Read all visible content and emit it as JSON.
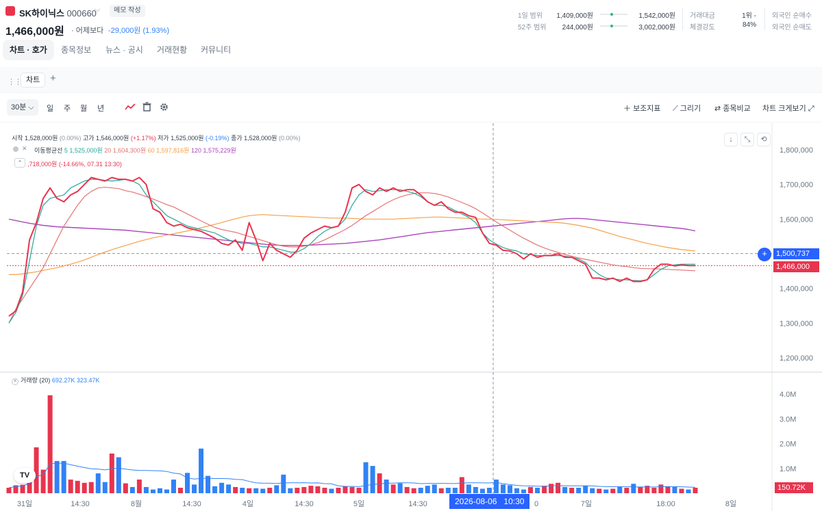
{
  "header": {
    "stock_name": "SK하이닉스",
    "stock_code": "000660",
    "memo_label": "메모 작성",
    "price": "1,466,000원",
    "change_label": "· 어제보다",
    "change_value": "-29,000원 (1.93%)",
    "range_1d_label": "1일 범위",
    "range_1d_low": "1,409,000원",
    "range_1d_high": "1,542,000원",
    "range_52w_label": "52주 범위",
    "range_52w_low": "244,000원",
    "range_52w_high": "3,002,000원",
    "trade_amount_label": "거래대금",
    "trade_amount_value": "1위 -",
    "strength_label": "체결강도",
    "strength_value": "84%",
    "foreign_buy_label": "외국인 순매수",
    "foreign_rate_label": "외국인 순매도"
  },
  "tabs": [
    {
      "label": "차트 · 호가"
    },
    {
      "label": "종목정보"
    },
    {
      "label": "뉴스 · 공시"
    },
    {
      "label": "거래현황"
    },
    {
      "label": "커뮤니티"
    }
  ],
  "panel": {
    "chart_tab": "차트",
    "add_tab": "+"
  },
  "toolbar": {
    "interval": "30분",
    "periods": [
      "일",
      "주",
      "월",
      "년"
    ],
    "indicators": "보조지표",
    "draw": "그리기",
    "compare": "종목비교",
    "enlarge": "차트 크게보기"
  },
  "legend": {
    "ohlc_text_1": "시작 1,528,000원",
    "ohlc_pct_1": "(0.00%)",
    "ohlc_text_2": "고가 1,546,000원",
    "ohlc_pct_2": "(+1.17%)",
    "ohlc_text_3": "저가 1,525,000원",
    "ohlc_pct_3": "(-0.19%)",
    "ohlc_text_4": "종가 1,528,000원",
    "ohlc_pct_4": "(0.00%)",
    "ma_label": "이동평균선",
    "ma5": "5 1,525,000원",
    "ma20": "20 1,604,300원",
    "ma60": "60 1,597,816원",
    "ma120": "120 1,575,229원",
    "low_note": ",718,000원 (-14.66%, 07.31 13:30)",
    "volume_label": "거래량 (20)",
    "volume_v1": "692.27K",
    "volume_v2": "323.47K"
  },
  "axis": {
    "price_ticks": [
      "1,800,000",
      "1,700,000",
      "1,600,000",
      "1,500,000",
      "1,400,000",
      "1,300,000",
      "1,200,000"
    ],
    "volume_ticks": [
      "4.0M",
      "3.0M",
      "2.0M",
      "1.0M"
    ],
    "x_ticks": [
      "31일",
      "14:30",
      "8월",
      "14:30",
      "4일",
      "14:30",
      "5일",
      "14:30",
      "0",
      "7일",
      "18:00",
      "8일"
    ],
    "crosshair_date": "2026-08-06",
    "crosshair_time": "10:30",
    "crosshair_price": "1,500,737",
    "last_price": "1,466,000",
    "last_volume": "150.72K"
  },
  "colors": {
    "up": "#e8344e",
    "down": "#3182f6",
    "ma5": "#26a69a",
    "ma20": "#e57373",
    "ma60": "#f5a04a",
    "ma120": "#ab47bc",
    "crosshair": "#2962ff"
  },
  "chart_data": {
    "type": "line",
    "title": "",
    "xlabel": "",
    "ylabel": "",
    "ylim": [
      1150000,
      1850000
    ],
    "x": [
      0,
      1,
      2,
      3,
      4,
      5,
      6,
      7,
      8,
      9,
      10,
      11,
      12,
      13,
      14,
      15,
      16,
      17,
      18,
      19,
      20,
      21,
      22,
      23,
      24,
      25,
      26,
      27,
      28,
      29,
      30,
      31,
      32,
      33,
      34,
      35,
      36,
      37,
      38,
      39,
      40,
      41,
      42,
      43,
      44,
      45,
      46,
      47,
      48,
      49,
      50,
      51,
      52,
      53,
      54,
      55,
      56,
      57,
      58,
      59,
      60,
      61,
      62,
      63,
      64,
      65,
      66,
      67,
      68,
      69,
      70,
      71,
      72,
      73,
      74,
      75,
      76,
      77,
      78,
      79,
      80,
      81,
      82,
      83,
      84,
      85,
      86,
      87,
      88,
      89,
      90,
      91,
      92,
      93,
      94,
      95,
      96,
      97,
      98,
      99,
      100
    ],
    "series": [
      {
        "name": "",
        "values": [
          1320000,
          1335000,
          1390000,
          1540000,
          1590000,
          1660000,
          1690000,
          1660000,
          1650000,
          1670000,
          1680000,
          1700000,
          1720000,
          1715000,
          1710000,
          1720000,
          1715000,
          1715000,
          1710000,
          1720000,
          1700000,
          1630000,
          1620000,
          1590000,
          1580000,
          1585000,
          1575000,
          1570000,
          1565000,
          1555000,
          1545000,
          1530000,
          1525000,
          1540000,
          1510000,
          1590000,
          1540000,
          1480000,
          1530000,
          1510000,
          1500000,
          1490000,
          1510000,
          1545000,
          1560000,
          1570000,
          1580000,
          1575000,
          1580000,
          1620000,
          1690000,
          1700000,
          1680000,
          1670000,
          1690000,
          1680000,
          1690000,
          1680000,
          1685000,
          1685000,
          1670000,
          1650000,
          1640000,
          1650000,
          1630000,
          1620000,
          1620000,
          1610000,
          1605000,
          1560000,
          1530000,
          1525000,
          1510000,
          1508000,
          1500000,
          1485000,
          1500000,
          1490000,
          1495000,
          1495000,
          1500000,
          1490000,
          1490000,
          1480000,
          1470000,
          1430000,
          1430000,
          1425000,
          1430000,
          1420000,
          1430000,
          1420000,
          1420000,
          1425000,
          1455000,
          1470000,
          1470000,
          1465000,
          1468000,
          1466000,
          1466000
        ]
      },
      {
        "name": "",
        "values": [
          1300000,
          1330000,
          1380000,
          1480000,
          1580000,
          1640000,
          1660000,
          1665000,
          1670000,
          1690000,
          1700000,
          1710000,
          1715000,
          1715000,
          1712000,
          1710000,
          1712000,
          1715000,
          1710000,
          1700000,
          1670000,
          1650000,
          1630000,
          1610000,
          1600000,
          1590000,
          1580000,
          1575000,
          1570000,
          1565000,
          1560000,
          1550000,
          1540000,
          1535000,
          1530000,
          1530000,
          1525000,
          1520000,
          1520000,
          1515000,
          1510000,
          1505000,
          1505000,
          1515000,
          1530000,
          1550000,
          1565000,
          1575000,
          1580000,
          1600000,
          1640000,
          1670000,
          1685000,
          1680000,
          1682000,
          1685000,
          1685000,
          1685000,
          1680000,
          1675000,
          1665000,
          1650000,
          1640000,
          1640000,
          1635000,
          1625000,
          1615000,
          1605000,
          1590000,
          1560000,
          1540000,
          1528000,
          1518000,
          1512000,
          1508000,
          1500000,
          1498000,
          1495000,
          1494000,
          1494000,
          1495000,
          1493000,
          1490000,
          1485000,
          1475000,
          1455000,
          1440000,
          1430000,
          1428000,
          1425000,
          1425000,
          1423000,
          1422000,
          1425000,
          1440000,
          1455000,
          1465000,
          1468000,
          1470000,
          1470000,
          1470000
        ]
      },
      {
        "name": "",
        "values": [
          1300000,
          1340000,
          1370000,
          1400000,
          1430000,
          1460000,
          1500000,
          1540000,
          1580000,
          1610000,
          1640000,
          1665000,
          1680000,
          1690000,
          1692000,
          1690000,
          1688000,
          1682000,
          1678000,
          1672000,
          1665000,
          1658000,
          1650000,
          1642000,
          1635000,
          1625000,
          1615000,
          1605000,
          1595000,
          1585000,
          1576000,
          1570000,
          1566000,
          1562000,
          1556000,
          1550000,
          1544000,
          1538000,
          1532000,
          1526000,
          1522000,
          1520000,
          1520000,
          1522000,
          1526000,
          1532000,
          1540000,
          1550000,
          1560000,
          1570000,
          1582000,
          1596000,
          1610000,
          1622000,
          1634000,
          1646000,
          1656000,
          1664000,
          1670000,
          1674000,
          1676000,
          1676000,
          1674000,
          1670000,
          1664000,
          1656000,
          1648000,
          1640000,
          1630000,
          1618000,
          1605000,
          1592000,
          1580000,
          1568000,
          1556000,
          1545000,
          1535000,
          1525000,
          1517000,
          1510000,
          1504000,
          1498000,
          1493000,
          1488000,
          1484000,
          1480000,
          1476000,
          1472000,
          1468000,
          1465000,
          1463000,
          1460000,
          1458000,
          1457000,
          1457000,
          1456000,
          1455000,
          1454000,
          1453000,
          1452000,
          1451000
        ]
      },
      {
        "name": "",
        "values": [
          1440000,
          1440000,
          1442000,
          1445000,
          1448000,
          1452000,
          1456000,
          1460000,
          1465000,
          1470000,
          1476000,
          1482000,
          1490000,
          1498000,
          1505000,
          1512000,
          1518000,
          1524000,
          1530000,
          1536000,
          1541000,
          1546000,
          1550000,
          1554000,
          1558000,
          1562000,
          1566000,
          1570000,
          1575000,
          1580000,
          1585000,
          1590000,
          1596000,
          1601000,
          1606000,
          1610000,
          1612000,
          1613000,
          1612000,
          1611000,
          1610000,
          1609000,
          1608000,
          1607000,
          1606000,
          1605000,
          1604000,
          1603000,
          1603000,
          1603000,
          1602000,
          1601000,
          1600000,
          1600000,
          1600000,
          1600000,
          1600000,
          1601000,
          1602000,
          1603000,
          1604000,
          1605000,
          1606000,
          1606000,
          1605000,
          1604000,
          1603000,
          1602000,
          1601000,
          1600000,
          1600000,
          1599000,
          1598000,
          1597000,
          1596000,
          1595000,
          1594000,
          1593000,
          1592000,
          1591000,
          1590000,
          1588000,
          1585000,
          1582000,
          1578000,
          1574000,
          1568000,
          1562000,
          1556000,
          1550000,
          1545000,
          1540000,
          1535000,
          1530000,
          1526000,
          1522000,
          1518000,
          1515000,
          1512000,
          1510000,
          1508000
        ]
      },
      {
        "name": "",
        "values": [
          1600000,
          1596000,
          1592000,
          1588000,
          1585000,
          1582000,
          1580000,
          1578000,
          1577000,
          1576000,
          1575000,
          1574000,
          1573000,
          1572000,
          1571000,
          1570000,
          1569000,
          1568000,
          1566000,
          1564000,
          1562000,
          1560000,
          1558000,
          1556000,
          1554000,
          1552000,
          1550000,
          1548000,
          1546000,
          1544000,
          1542000,
          1540000,
          1538000,
          1536000,
          1534000,
          1532000,
          1530000,
          1528000,
          1526000,
          1525000,
          1524000,
          1524000,
          1524000,
          1524000,
          1525000,
          1526000,
          1527000,
          1528000,
          1529000,
          1530000,
          1532000,
          1534000,
          1536000,
          1538000,
          1540000,
          1543000,
          1546000,
          1549000,
          1552000,
          1555000,
          1558000,
          1561000,
          1563000,
          1565000,
          1567000,
          1569000,
          1571000,
          1573000,
          1575000,
          1577000,
          1579000,
          1581000,
          1583000,
          1585000,
          1587000,
          1589000,
          1591000,
          1593000,
          1595000,
          1597000,
          1599000,
          1601000,
          1602000,
          1602000,
          1601000,
          1599000,
          1597000,
          1595000,
          1593000,
          1591000,
          1589000,
          1587000,
          1585000,
          1583000,
          1581000,
          1579000,
          1577000,
          1575000,
          1573000,
          1570000,
          1566000
        ]
      }
    ],
    "volume": [
      0.22,
      0.32,
      0.34,
      0.7,
      1.85,
      0.95,
      3.95,
      1.3,
      1.3,
      0.55,
      0.5,
      0.42,
      0.45,
      0.8,
      0.45,
      1.6,
      1.45,
      0.4,
      0.25,
      0.55,
      0.25,
      0.15,
      0.2,
      0.15,
      0.55,
      0.22,
      0.82,
      0.35,
      1.8,
      0.7,
      0.28,
      0.42,
      0.35,
      0.25,
      0.22,
      0.2,
      0.2,
      0.18,
      0.22,
      0.32,
      0.75,
      0.2,
      0.22,
      0.25,
      0.3,
      0.28,
      0.22,
      0.18,
      0.22,
      0.28,
      0.25,
      0.22,
      1.25,
      1.1,
      0.8,
      0.55,
      0.35,
      0.4,
      0.25,
      0.2,
      0.22,
      0.3,
      0.35,
      0.2,
      0.22,
      0.22,
      0.65,
      0.35,
      0.25,
      0.18,
      0.22,
      0.55,
      0.35,
      0.32,
      0.2,
      0.15,
      0.25,
      0.22,
      0.3,
      0.38,
      0.42,
      0.25,
      0.22,
      0.22,
      0.3,
      0.2,
      0.18,
      0.15,
      0.18,
      0.25,
      0.22,
      0.38,
      0.25,
      0.3,
      0.22,
      0.35,
      0.28,
      0.25,
      0.18,
      0.15,
      0.22
    ]
  }
}
